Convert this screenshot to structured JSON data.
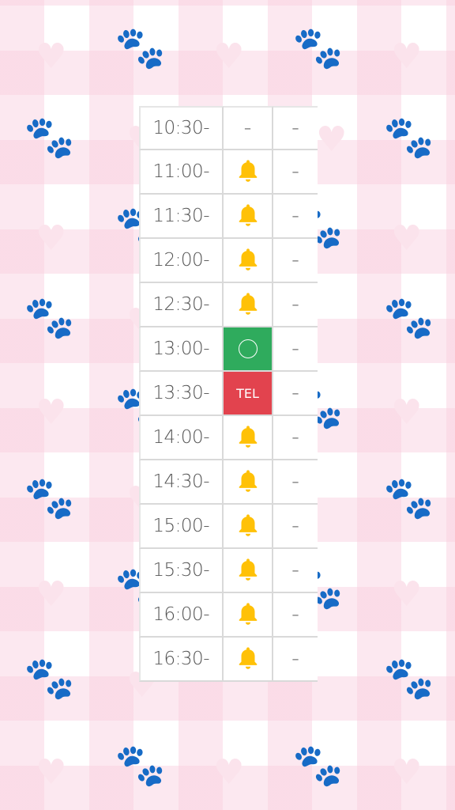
{
  "rows": [
    {
      "time": "10:30-",
      "slot1": {
        "type": "dash",
        "text": "–"
      },
      "slot2": "–"
    },
    {
      "time": "11:00-",
      "slot1": {
        "type": "bell"
      },
      "slot2": "–"
    },
    {
      "time": "11:30-",
      "slot1": {
        "type": "bell"
      },
      "slot2": "–"
    },
    {
      "time": "12:00-",
      "slot1": {
        "type": "bell"
      },
      "slot2": "–"
    },
    {
      "time": "12:30-",
      "slot1": {
        "type": "bell"
      },
      "slot2": "–"
    },
    {
      "time": "13:00-",
      "slot1": {
        "type": "open"
      },
      "slot2": "–"
    },
    {
      "time": "13:30-",
      "slot1": {
        "type": "tel",
        "text": "TEL"
      },
      "slot2": "–"
    },
    {
      "time": "14:00-",
      "slot1": {
        "type": "bell"
      },
      "slot2": "–"
    },
    {
      "time": "14:30-",
      "slot1": {
        "type": "bell"
      },
      "slot2": "–"
    },
    {
      "time": "15:00-",
      "slot1": {
        "type": "bell"
      },
      "slot2": "–"
    },
    {
      "time": "15:30-",
      "slot1": {
        "type": "bell"
      },
      "slot2": "–"
    },
    {
      "time": "16:00-",
      "slot1": {
        "type": "bell"
      },
      "slot2": "–"
    },
    {
      "time": "16:30-",
      "slot1": {
        "type": "bell"
      },
      "slot2": "–"
    }
  ],
  "icons": {
    "bell": "bell-icon",
    "open": "circle-icon",
    "background_paw": "paw-icon",
    "background_heart": "heart-icon"
  },
  "colors": {
    "bell": "#FFC107",
    "open": "#2FAB5D",
    "tel": "#E2434E",
    "background_stripe": "#F9CDDD"
  }
}
